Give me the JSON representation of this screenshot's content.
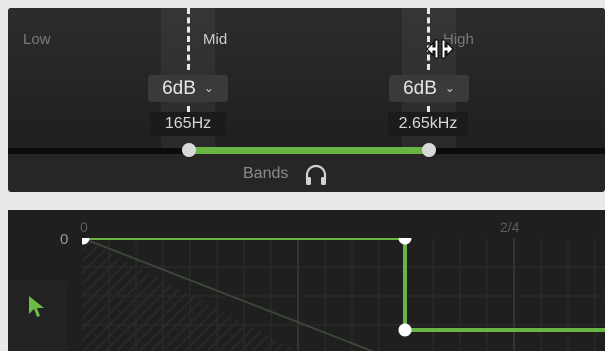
{
  "crossover": {
    "bands": {
      "low_label": "Low",
      "mid_label": "Mid",
      "high_label": "High"
    },
    "mid_gain": "6dB",
    "high_gain": "6dB",
    "low_mid_frequency": "165Hz",
    "mid_high_frequency": "2.65kHz",
    "bands_button_label": "Bands"
  },
  "envelope_graph": {
    "x_tick_start": "0",
    "x_tick_mid": "2/4",
    "y_tick": "0",
    "accent_color": "#68b543"
  },
  "icons": {
    "dropdown": "chevron-down-icon",
    "headphones": "headphones-icon",
    "resize_cursor": "horizontal-resize-cursor-icon",
    "pointer": "pointer-cursor-icon"
  }
}
